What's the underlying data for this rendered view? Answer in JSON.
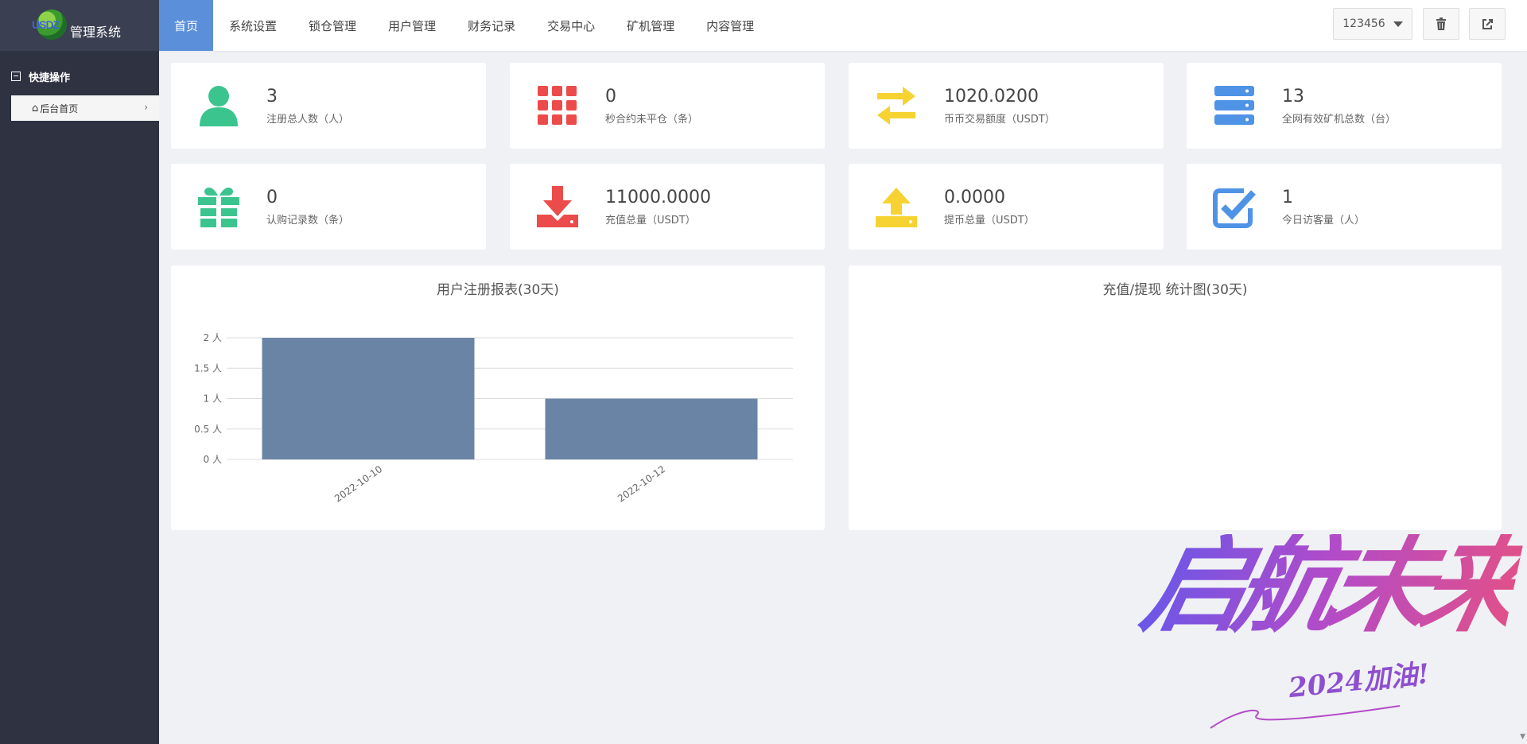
{
  "logo": {
    "brand": "USDZ",
    "title": "管理系统"
  },
  "sidebar": {
    "section_title": "快捷操作",
    "items": [
      {
        "label": "后台首页"
      }
    ]
  },
  "nav": {
    "items": [
      {
        "label": "首页",
        "active": true
      },
      {
        "label": "系统设置"
      },
      {
        "label": "锁仓管理"
      },
      {
        "label": "用户管理"
      },
      {
        "label": "财务记录"
      },
      {
        "label": "交易中心"
      },
      {
        "label": "矿机管理"
      },
      {
        "label": "内容管理"
      }
    ],
    "account": "123456",
    "icons": [
      "trash-icon",
      "sign-out-icon"
    ]
  },
  "stats": [
    {
      "value": "3",
      "label": "注册总人数（人）",
      "icon": "user-icon",
      "color": "#3cc48f"
    },
    {
      "value": "0",
      "label": "秒合约未平仓（条）",
      "icon": "grid-icon",
      "color": "#ec4b4b"
    },
    {
      "value": "1020.0200",
      "label": "币币交易额度（USDT）",
      "icon": "exchange-icon",
      "color": "#f6d332"
    },
    {
      "value": "13",
      "label": "全网有效矿机总数（台）",
      "icon": "server-icon",
      "color": "#4f93e6"
    },
    {
      "value": "0",
      "label": "认购记录数（条）",
      "icon": "gift-icon",
      "color": "#3cc48f"
    },
    {
      "value": "11000.0000",
      "label": "充值总量（USDT）",
      "icon": "download-icon",
      "color": "#ec4b4b"
    },
    {
      "value": "0.0000",
      "label": "提币总量（USDT）",
      "icon": "upload-icon",
      "color": "#f6d332"
    },
    {
      "value": "1",
      "label": "今日访客量（人）",
      "icon": "check-square-icon",
      "color": "#4f93e6"
    }
  ],
  "panels": {
    "registration_title": "用户注册报表(30天)",
    "deposit_title": "充值/提现 统计图(30天)"
  },
  "chart_data": {
    "type": "bar",
    "title": "用户注册报表(30天)",
    "categories": [
      "2022-10-10",
      "2022-10-12"
    ],
    "values": [
      2,
      1
    ],
    "y_ticks": [
      "0 人",
      "0.5 人",
      "1 人",
      "1.5 人",
      "2 人"
    ],
    "ylim": [
      0,
      2
    ],
    "grid": true,
    "bar_color": "#6a84a6"
  },
  "watermark": {
    "main": "启航未来",
    "sub": "2024加油!"
  }
}
